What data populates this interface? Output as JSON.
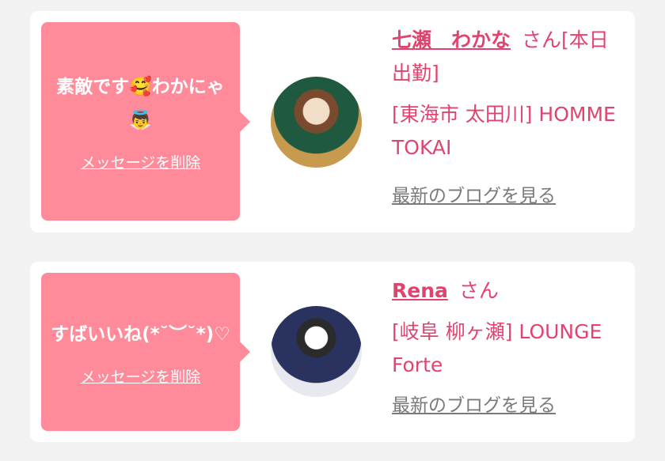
{
  "delete_label": "メッセージを削除",
  "blog_label": "最新のブログを見る",
  "honorific": "さん",
  "colors": {
    "background": "#f2f2f2",
    "bubble": "#ff8b9a",
    "accent": "#e0446e",
    "muted_link": "#7a7a7a"
  },
  "cards": [
    {
      "message": "素敵です🥰わかにゃ👼",
      "name": "七瀬　わかな",
      "status": "[本日出勤]",
      "shop": "[東海市 太田川] HOMME TOKAI"
    },
    {
      "message": "すばいいね(*˘︶˘*)♡",
      "name": "Rena",
      "status": "",
      "shop": "[岐阜 柳ヶ瀬] LOUNGE Forte"
    }
  ]
}
